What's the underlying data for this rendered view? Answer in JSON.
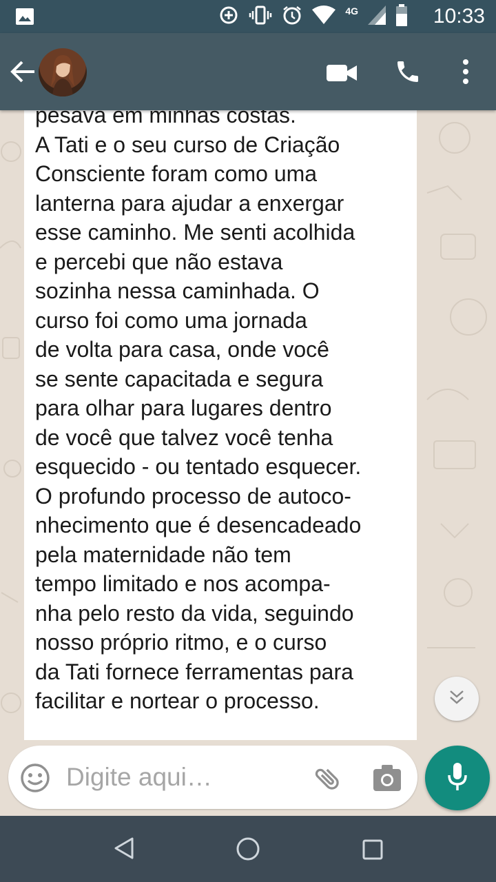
{
  "status_bar": {
    "time": "10:33",
    "network": "4G",
    "icons": [
      "gallery-icon",
      "data-saver-icon",
      "vibrate-icon",
      "alarm-icon",
      "wifi-icon",
      "signal-icon",
      "battery-icon"
    ]
  },
  "app_bar": {
    "icons": [
      "back-arrow-icon",
      "video-call-icon",
      "phone-icon",
      "more-options-icon"
    ],
    "color": "#455a64"
  },
  "message": {
    "text": "pesava em minhas costas.\nA Tati e o seu curso de Criação\nConsciente foram como uma\nlanterna para ajudar a enxergar\nesse caminho. Me senti acolhida\ne percebi que não estava\nsozinha nessa caminhada. O\ncurso foi como uma jornada\nde volta para casa, onde você\nse sente capacitada e segura\npara olhar para lugares dentro\nde você que talvez você tenha\nesquecido - ou tentado esquecer.\nO profundo processo de autoco-\nnhecimento que é desencadeado\npela maternidade não tem\ntempo limitado e nos acompa-\nnha pelo resto da vida, seguindo\nnosso próprio ritmo, e o curso\nda Tati fornece ferramentas para\nfacilitar e nortear o processo."
  },
  "composer": {
    "placeholder": "Digite aqui…"
  },
  "colors": {
    "accent": "#128c7e",
    "status_bar": "#36525f",
    "chat_background": "#e6ddd3"
  }
}
